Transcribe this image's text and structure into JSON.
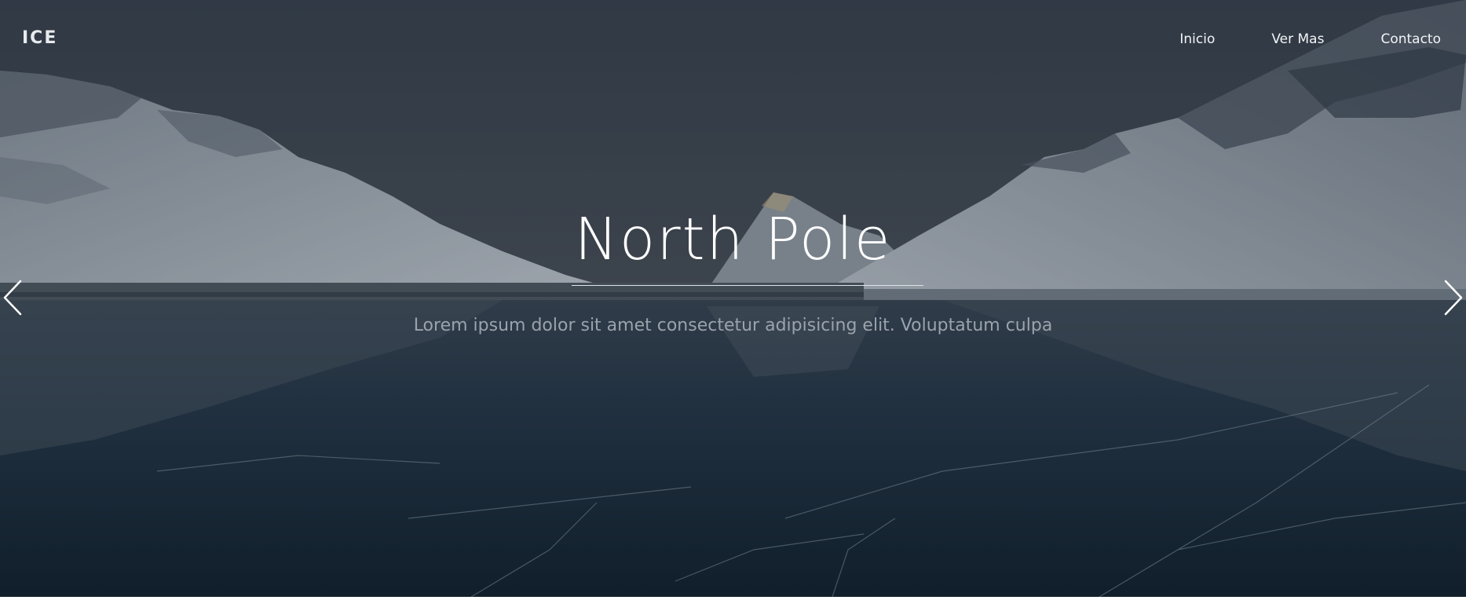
{
  "brand": {
    "logo_text": "ICE"
  },
  "nav": {
    "items": [
      {
        "label": "Inicio"
      },
      {
        "label": "Ver Mas"
      },
      {
        "label": "Contacto"
      }
    ]
  },
  "hero": {
    "title": "North Pole",
    "subtitle": "Lorem ipsum dolor sit amet consectetur adipisicing elit. Voluptatum culpa",
    "prev_icon": "chevron-left-icon",
    "next_icon": "chevron-right-icon"
  },
  "colors": {
    "sky": "#3b4450",
    "snow": "#c9d0d8",
    "ice": "#1b2a36",
    "text": "#ffffff",
    "subtitle": "#9aa3ad"
  }
}
